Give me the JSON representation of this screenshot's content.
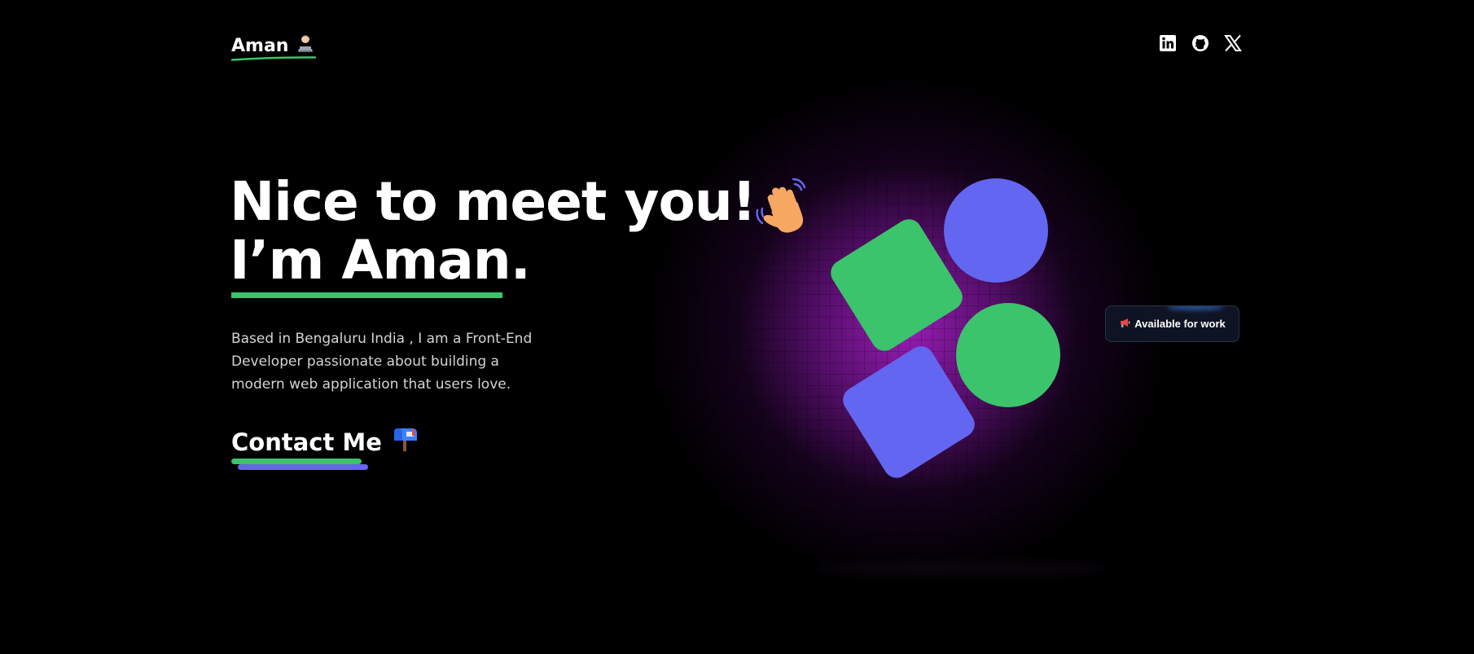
{
  "header": {
    "logo_text": "Aman",
    "logo_emoji": "technologist-emoji",
    "social_links": [
      {
        "name": "linkedin-icon"
      },
      {
        "name": "github-icon"
      },
      {
        "name": "x-icon"
      }
    ]
  },
  "hero": {
    "headline_line1": "Nice to meet you!",
    "headline_line2": "I’m Aman.",
    "wave_emoji": "waving-hand-emoji",
    "intro": "Based in Bengaluru India , I am a Front-End Developer passionate about building a modern web application that users love.",
    "contact_label": "Contact Me",
    "contact_emoji": "mailbox-emoji"
  },
  "badge": {
    "label": "Available for work",
    "icon": "megaphone-icon"
  },
  "colors": {
    "background": "#000000",
    "accent_green": "#3bc46b",
    "accent_blue": "#6366f1",
    "glow_purple": "#a01ebe",
    "badge_bg": "#0f1424",
    "text_primary": "#ffffff",
    "text_secondary": "#d4d4d8"
  }
}
